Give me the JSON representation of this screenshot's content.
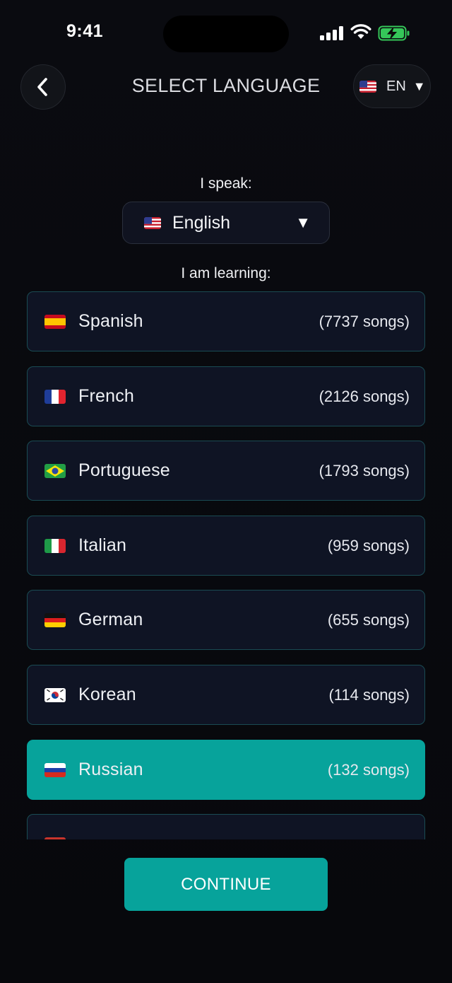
{
  "status_bar": {
    "time": "9:41"
  },
  "header": {
    "title": "SELECT LANGUAGE",
    "ui_language_code": "EN",
    "back_icon": "chevron-left-icon",
    "caret_icon": "caret-down-icon"
  },
  "speak": {
    "label": "I speak:",
    "selected": "English",
    "flag": "us-flag-icon"
  },
  "learning": {
    "label": "I am learning:",
    "items": [
      {
        "name": "Spanish",
        "count": "(7737 songs)",
        "flag": "es",
        "selected": false
      },
      {
        "name": "French",
        "count": "(2126 songs)",
        "flag": "fr",
        "selected": false
      },
      {
        "name": "Portuguese",
        "count": "(1793 songs)",
        "flag": "br",
        "selected": false
      },
      {
        "name": "Italian",
        "count": "(959 songs)",
        "flag": "it",
        "selected": false
      },
      {
        "name": "German",
        "count": "(655 songs)",
        "flag": "de",
        "selected": false
      },
      {
        "name": "Korean",
        "count": "(114 songs)",
        "flag": "kr",
        "selected": false
      },
      {
        "name": "Russian",
        "count": "(132 songs)",
        "flag": "ru",
        "selected": true
      }
    ]
  },
  "continue_label": "CONTINUE",
  "colors": {
    "accent": "#07a39b",
    "card_bg": "#0f1424",
    "card_border": "#1a4b53",
    "background": "#08090d"
  }
}
